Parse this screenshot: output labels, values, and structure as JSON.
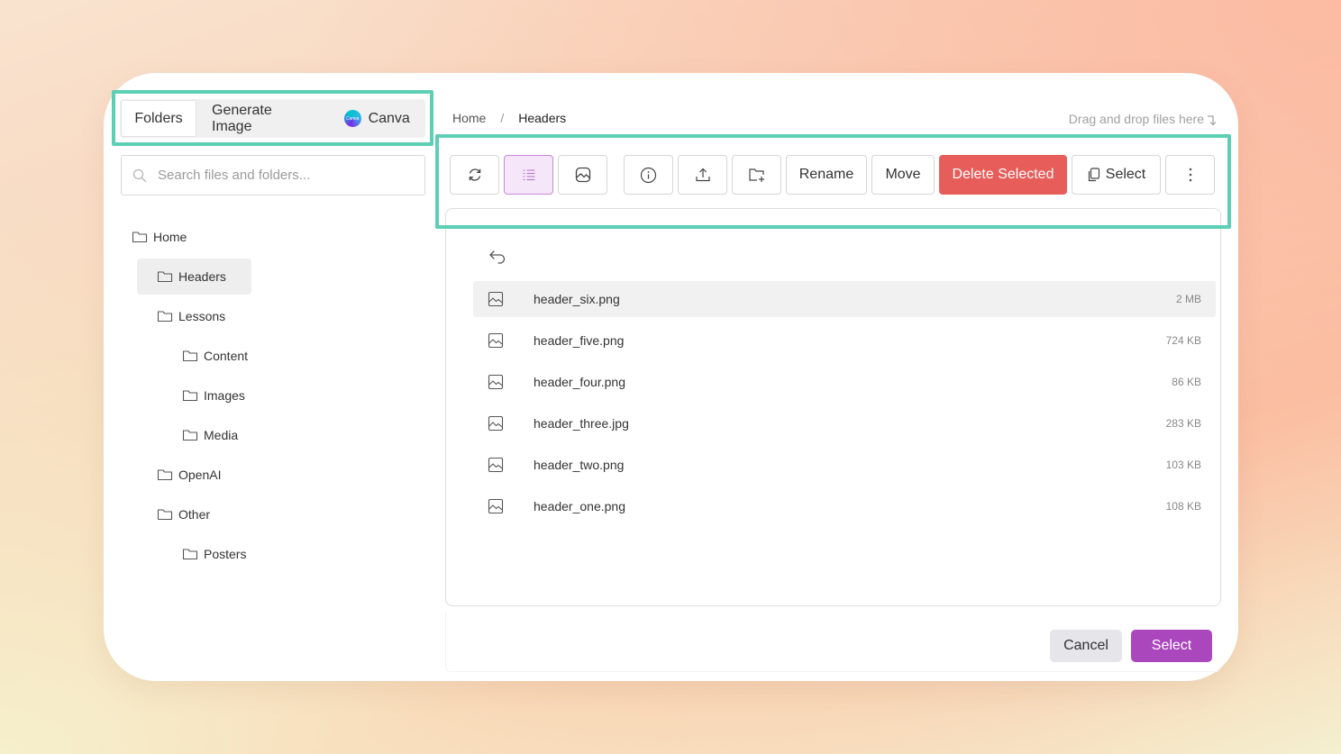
{
  "tabs": [
    {
      "label": "Folders",
      "active": true
    },
    {
      "label": "Generate Image",
      "active": false
    },
    {
      "label": "Canva",
      "active": false
    }
  ],
  "canva_logo_text": "Canva",
  "search": {
    "placeholder": "Search files and folders..."
  },
  "tree": [
    {
      "label": "Home",
      "level": 0,
      "selected": false
    },
    {
      "label": "Headers",
      "level": 1,
      "selected": true
    },
    {
      "label": "Lessons",
      "level": 1,
      "selected": false
    },
    {
      "label": "Content",
      "level": 2,
      "selected": false
    },
    {
      "label": "Images",
      "level": 2,
      "selected": false
    },
    {
      "label": "Media",
      "level": 2,
      "selected": false
    },
    {
      "label": "OpenAI",
      "level": 1,
      "selected": false
    },
    {
      "label": "Other",
      "level": 1,
      "selected": false
    },
    {
      "label": "Posters",
      "level": 2,
      "selected": false
    }
  ],
  "breadcrumb": {
    "home": "Home",
    "separator": "/",
    "current": "Headers"
  },
  "drop_hint": "Drag and drop files here",
  "toolbar": {
    "refresh_icon": "refresh-icon",
    "list_view_icon": "list-view-icon",
    "grid_view_icon": "image-grid-icon",
    "info_icon": "info-icon",
    "upload_icon": "upload-icon",
    "new_folder_icon": "new-folder-icon",
    "rename_label": "Rename",
    "move_label": "Move",
    "delete_label": "Delete Selected",
    "select_label": "Select",
    "more_icon": "more-vertical-icon"
  },
  "files": [
    {
      "name": "header_six.png",
      "size": "2 MB"
    },
    {
      "name": "header_five.png",
      "size": "724 KB"
    },
    {
      "name": "header_four.png",
      "size": "86 KB"
    },
    {
      "name": "header_three.jpg",
      "size": "283 KB"
    },
    {
      "name": "header_two.png",
      "size": "103 KB"
    },
    {
      "name": "header_one.png",
      "size": "108 KB"
    }
  ],
  "footer": {
    "cancel_label": "Cancel",
    "select_label": "Select"
  },
  "colors": {
    "highlight": "#5dcfb4",
    "danger": "#e65d5a",
    "primary": "#aa47bc",
    "active_view": "#f6e6fa"
  }
}
